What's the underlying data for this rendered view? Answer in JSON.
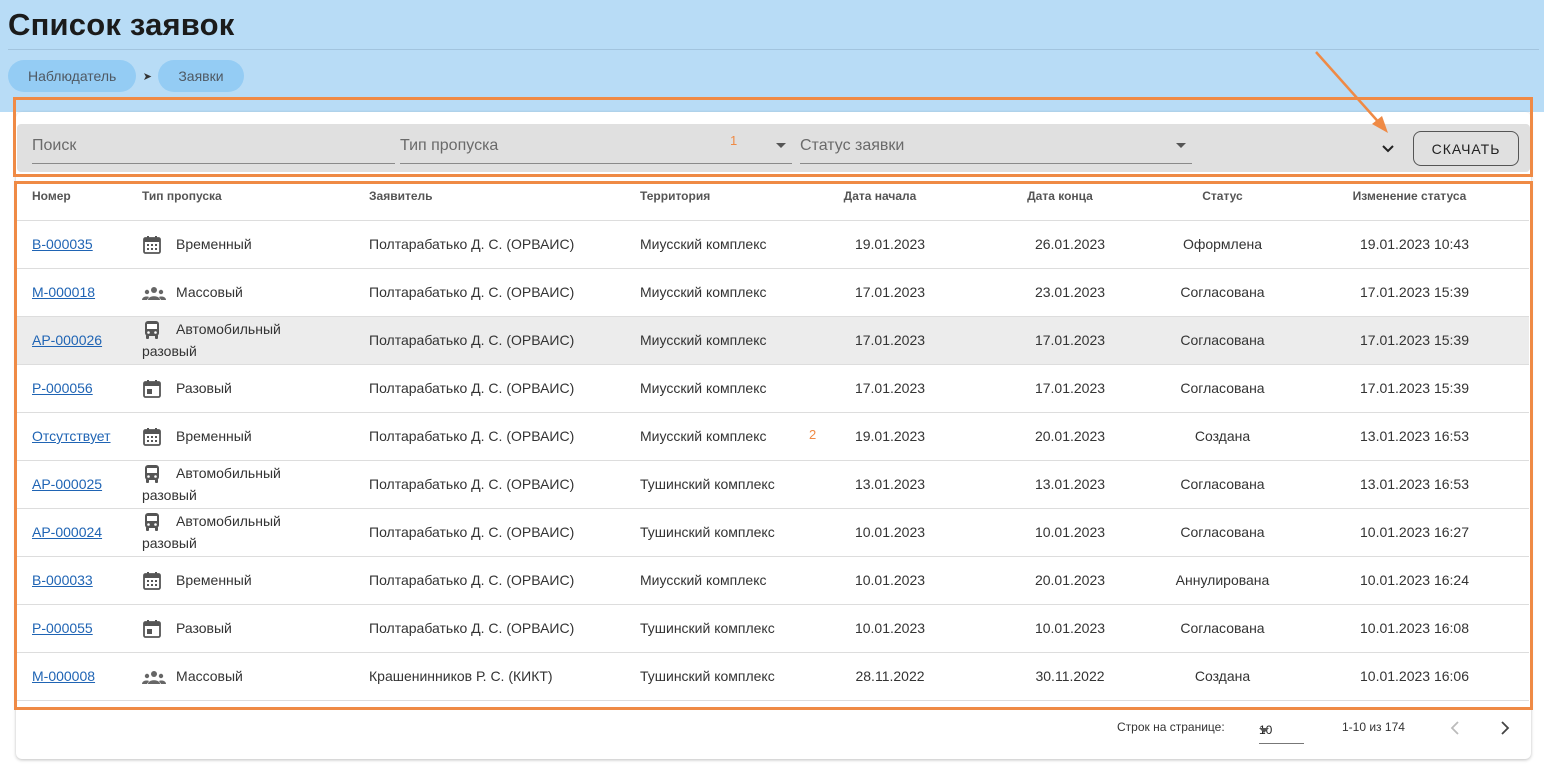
{
  "header": {
    "title": "Список заявок",
    "breadcrumb": [
      "Наблюдатель",
      "Заявки"
    ]
  },
  "filters": {
    "search_placeholder": "Поиск",
    "pass_type_placeholder": "Тип пропуска",
    "status_placeholder": "Статус заявки",
    "download_label": "СКАЧАТЬ"
  },
  "annotations": {
    "label_1": "1",
    "label_2": "2",
    "color": "#ef8a45"
  },
  "table": {
    "columns": [
      "Номер",
      "Тип пропуска",
      "Заявитель",
      "Территория",
      "Дата начала",
      "Дата конца",
      "Статус",
      "Изменение статуса"
    ],
    "rows": [
      {
        "number": "В-000035",
        "type": "Временный",
        "icon": "calendar-grid-icon",
        "applicant": "Полтарабатько Д. С. (ОРВАИС)",
        "territory": "Миусский комплекс",
        "start": "19.01.2023",
        "end": "26.01.2023",
        "status": "Оформлена",
        "changed": "19.01.2023 10:43"
      },
      {
        "number": "М-000018",
        "type": "Массовый",
        "icon": "group-icon",
        "applicant": "Полтарабатько Д. С. (ОРВАИС)",
        "territory": "Миусский комплекс",
        "start": "17.01.2023",
        "end": "23.01.2023",
        "status": "Согласована",
        "changed": "17.01.2023 15:39"
      },
      {
        "number": "АР-000026",
        "type": "Автомобильный разовый",
        "icon": "bus-icon",
        "applicant": "Полтарабатько Д. С. (ОРВАИС)",
        "territory": "Миусский комплекс",
        "start": "17.01.2023",
        "end": "17.01.2023",
        "status": "Согласована",
        "changed": "17.01.2023 15:39",
        "highlight": true
      },
      {
        "number": "Р-000056",
        "type": "Разовый",
        "icon": "calendar-day-icon",
        "applicant": "Полтарабатько Д. С. (ОРВАИС)",
        "territory": "Миусский комплекс",
        "start": "17.01.2023",
        "end": "17.01.2023",
        "status": "Согласована",
        "changed": "17.01.2023 15:39"
      },
      {
        "number": "Отсутствует",
        "type": "Временный",
        "icon": "calendar-grid-icon",
        "applicant": "Полтарабатько Д. С. (ОРВАИС)",
        "territory": "Миусский комплекс",
        "start": "19.01.2023",
        "end": "20.01.2023",
        "status": "Создана",
        "changed": "13.01.2023 16:53"
      },
      {
        "number": "АР-000025",
        "type": "Автомобильный разовый",
        "icon": "bus-icon",
        "applicant": "Полтарабатько Д. С. (ОРВАИС)",
        "territory": "Тушинский комплекс",
        "start": "13.01.2023",
        "end": "13.01.2023",
        "status": "Согласована",
        "changed": "13.01.2023 16:53"
      },
      {
        "number": "АР-000024",
        "type": "Автомобильный разовый",
        "icon": "bus-icon",
        "applicant": "Полтарабатько Д. С. (ОРВАИС)",
        "territory": "Тушинский комплекс",
        "start": "10.01.2023",
        "end": "10.01.2023",
        "status": "Согласована",
        "changed": "10.01.2023 16:27"
      },
      {
        "number": "В-000033",
        "type": "Временный",
        "icon": "calendar-grid-icon",
        "applicant": "Полтарабатько Д. С. (ОРВАИС)",
        "territory": "Миусский комплекс",
        "start": "10.01.2023",
        "end": "20.01.2023",
        "status": "Аннулирована",
        "changed": "10.01.2023 16:24"
      },
      {
        "number": "Р-000055",
        "type": "Разовый",
        "icon": "calendar-day-icon",
        "applicant": "Полтарабатько Д. С. (ОРВАИС)",
        "territory": "Тушинский комплекс",
        "start": "10.01.2023",
        "end": "10.01.2023",
        "status": "Согласована",
        "changed": "10.01.2023 16:08"
      },
      {
        "number": "М-000008",
        "type": "Массовый",
        "icon": "group-icon",
        "applicant": "Крашенинников Р. С. (КИКТ)",
        "territory": "Тушинский комплекс",
        "start": "28.11.2022",
        "end": "30.11.2022",
        "status": "Создана",
        "changed": "10.01.2023 16:06"
      }
    ]
  },
  "pagination": {
    "rows_per_page_label": "Строк на странице:",
    "rows_per_page": "10",
    "range": "1-10 из 174"
  }
}
